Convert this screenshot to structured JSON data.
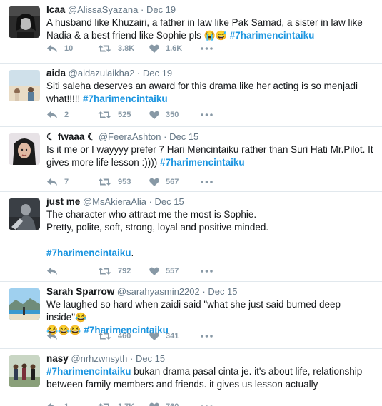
{
  "tweets": [
    {
      "fullname": "Icaa",
      "handle": "@AlissaSyazana",
      "date": "Dec 19",
      "lines": [
        [
          {
            "t": "A husband like Khuzairi, a father in law like Pak Samad, a sister in law like"
          }
        ],
        [
          {
            "t": "Nadia & a best friend like Sophie pls "
          },
          {
            "t": "😭😅",
            "e": true
          },
          {
            "t": " "
          },
          {
            "t": "#7harimencintaiku",
            "h": true
          }
        ]
      ],
      "reply_count": "10",
      "retweet_count": "3.8K",
      "like_count": "1.6K"
    },
    {
      "fullname": "aida",
      "handle": "@aidazulaikha2",
      "date": "Dec 19",
      "lines": [
        [
          {
            "t": "Siti saleha deserves an award for this drama like her acting is so menjadi"
          }
        ],
        [
          {
            "t": "what!!!!!  "
          },
          {
            "t": "#7harimencintaiku",
            "h": true
          }
        ]
      ],
      "reply_count": "2",
      "retweet_count": "525",
      "like_count": "350"
    },
    {
      "fullname": "☾ fwaaa ☾",
      "handle": "@FeeraAshton",
      "date": "Dec 15",
      "lines": [
        [
          {
            "t": "Is it me or I wayyyy prefer 7 Hari Mencintaiku rather than Suri Hati Mr.Pilot. It"
          }
        ],
        [
          {
            "t": "gives more life lesson :)))) "
          },
          {
            "t": "#7harimencintaiku",
            "h": true
          }
        ]
      ],
      "reply_count": "7",
      "retweet_count": "953",
      "like_count": "567"
    },
    {
      "fullname": "just me",
      "handle": "@MsAkieraAlia",
      "date": "Dec 15",
      "lines": [
        [
          {
            "t": "The character who attract me the most is Sophie."
          }
        ],
        [
          {
            "t": "Pretty, polite, soft, strong, loyal and positive minded."
          }
        ],
        [],
        [
          {
            "t": "#7harimencintaiku",
            "h": true
          },
          {
            "t": "."
          }
        ]
      ],
      "reply_count": "",
      "retweet_count": "792",
      "like_count": "557"
    },
    {
      "fullname": "Sarah Sparrow",
      "handle": "@sarahyasmin2202",
      "date": "Dec 15",
      "lines": [
        [
          {
            "t": "We laughed so hard when zaidi said \"what she just said burned deep inside\""
          },
          {
            "t": "😂",
            "e": true
          }
        ],
        [
          {
            "t": "😂😂😂",
            "e": true
          },
          {
            "t": " "
          },
          {
            "t": "#7harimencintaiku",
            "h": true
          }
        ]
      ],
      "reply_count": "",
      "retweet_count": "460",
      "like_count": "341"
    },
    {
      "fullname": "nasy",
      "handle": "@nrhzwnsyth",
      "date": "Dec 15",
      "lines": [
        [
          {
            "t": "#7harimencintaiku",
            "h": true
          },
          {
            "t": " bukan drama pasal cinta je. it's about life, relationship"
          }
        ],
        [
          {
            "t": "between family members and friends. it gives us lesson actually"
          }
        ]
      ],
      "reply_count": "1",
      "retweet_count": "1.7K",
      "like_count": "760"
    }
  ],
  "icons": {
    "reply": "reply-icon",
    "retweet": "retweet-icon",
    "like": "heart-icon",
    "more": "more-icon"
  },
  "colors": {
    "hashtag": "#1b95e0",
    "icon": "#8899a6",
    "meta": "#657786",
    "text": "#14171a",
    "divider": "#e1e8ed"
  }
}
